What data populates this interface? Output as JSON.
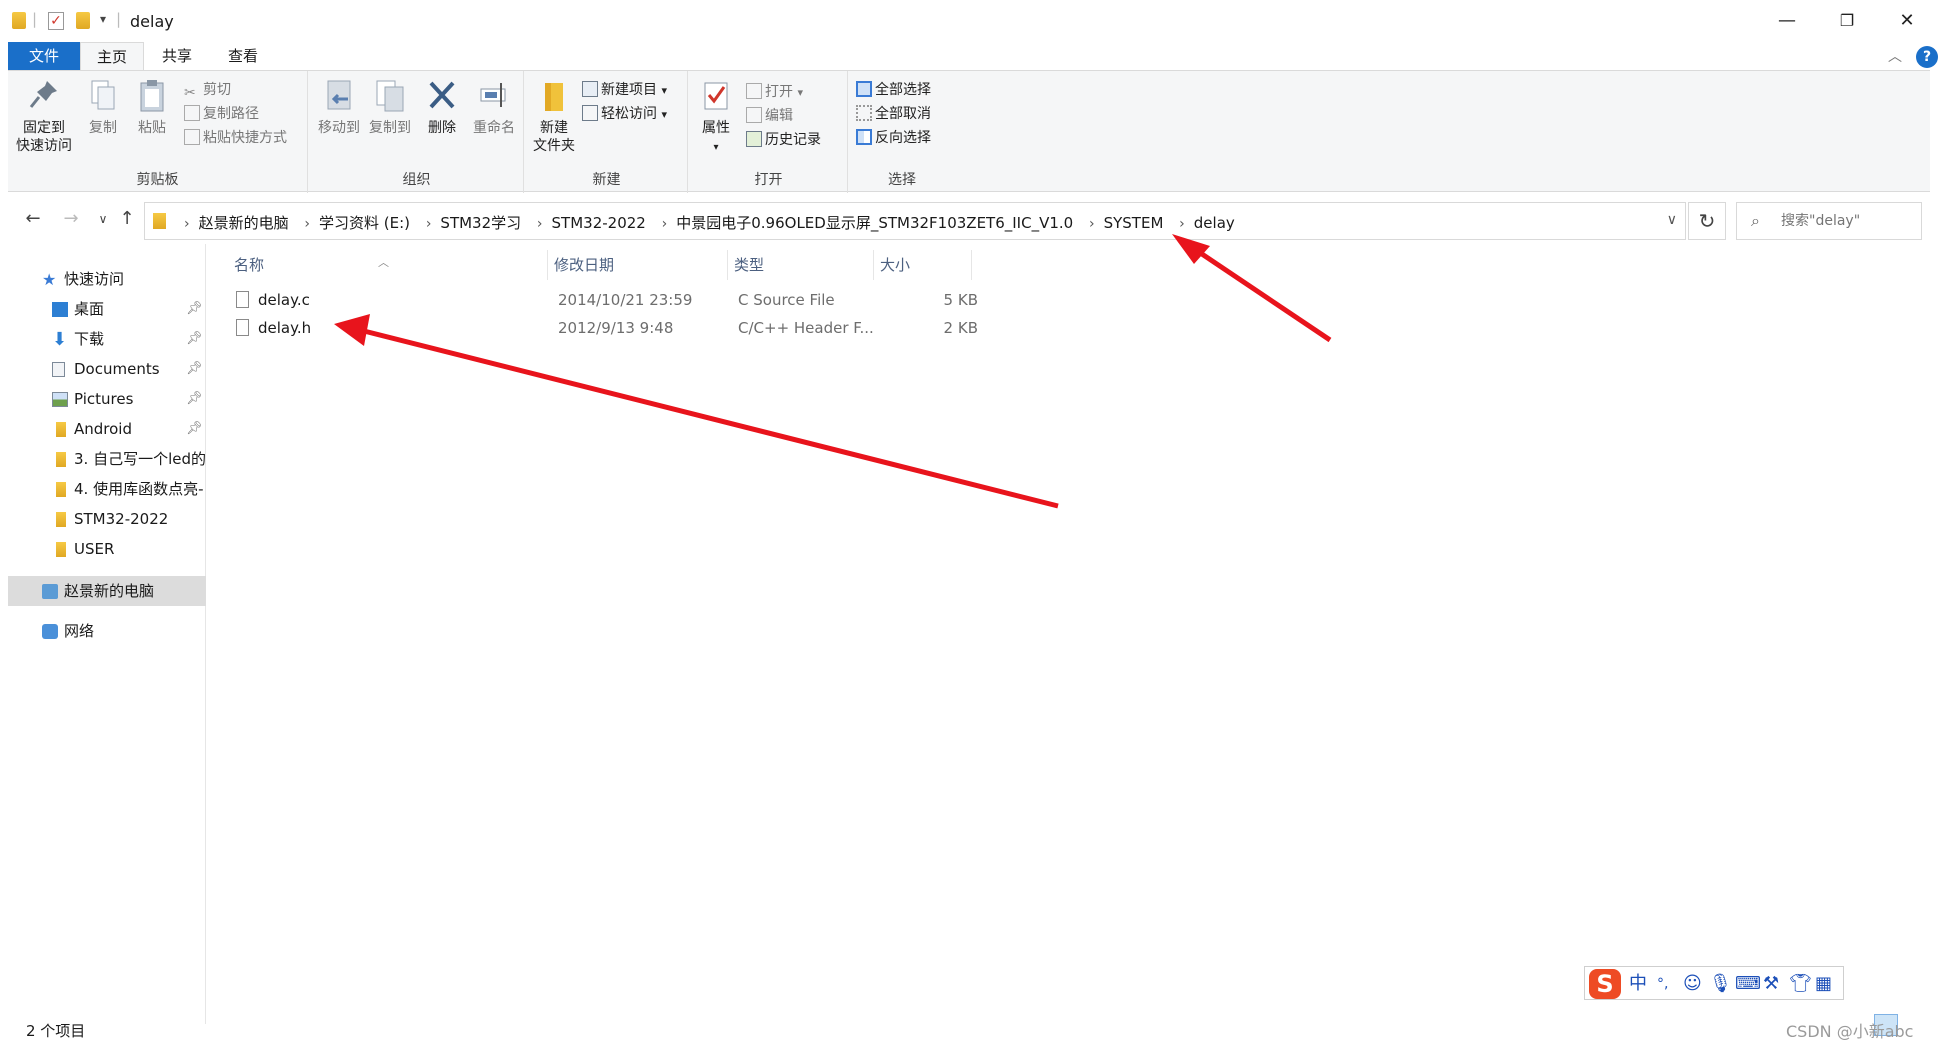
{
  "window": {
    "title": "delay",
    "controls": {
      "minimize": "—",
      "maximize": "❐",
      "close": "✕"
    }
  },
  "ribbon_tabs": [
    "文件",
    "主页",
    "共享",
    "查看"
  ],
  "ribbon": {
    "clipboard": {
      "label": "剪贴板",
      "pin_line1": "固定到",
      "pin_line2": "快速访问",
      "copy": "复制",
      "paste": "粘贴",
      "cut": "剪切",
      "copy_path": "复制路径",
      "paste_shortcut": "粘贴快捷方式"
    },
    "organize": {
      "label": "组织",
      "move_to": "移动到",
      "copy_to": "复制到",
      "delete": "删除",
      "rename": "重命名"
    },
    "new": {
      "label": "新建",
      "new_folder_line1": "新建",
      "new_folder_line2": "文件夹",
      "new_item": "新建项目",
      "easy_access": "轻松访问"
    },
    "open": {
      "label": "打开",
      "properties": "属性",
      "open": "打开",
      "edit": "编辑",
      "history": "历史记录"
    },
    "select": {
      "label": "选择",
      "select_all": "全部选择",
      "select_none": "全部取消",
      "invert": "反向选择"
    }
  },
  "address": {
    "crumbs": [
      "赵景新的电脑",
      "学习资料 (E:)",
      "STM32学习",
      "STM32-2022",
      "中景园电子0.96OLED显示屏_STM32F103ZET6_IIC_V1.0",
      "SYSTEM",
      "delay"
    ]
  },
  "search": {
    "placeholder": "搜索\"delay\""
  },
  "sidebar": {
    "quick_access": "快速访问",
    "items": [
      {
        "label": "桌面",
        "pinned": true
      },
      {
        "label": "下载",
        "pinned": true
      },
      {
        "label": "Documents",
        "pinned": true
      },
      {
        "label": "Pictures",
        "pinned": true
      },
      {
        "label": "Android",
        "pinned": true
      },
      {
        "label": "3. 自己写一个led的",
        "pinned": false
      },
      {
        "label": "4. 使用库函数点亮-",
        "pinned": false
      },
      {
        "label": "STM32-2022",
        "pinned": false
      },
      {
        "label": "USER",
        "pinned": false
      }
    ],
    "this_pc": "赵景新的电脑",
    "network": "网络"
  },
  "columns": {
    "name": "名称",
    "date": "修改日期",
    "type": "类型",
    "size": "大小"
  },
  "files": [
    {
      "name": "delay.c",
      "date": "2014/10/21 23:59",
      "type": "C Source File",
      "size": "5 KB"
    },
    {
      "name": "delay.h",
      "date": "2012/9/13 9:48",
      "type": "C/C++ Header F...",
      "size": "2 KB"
    }
  ],
  "status": {
    "count": "2 个项目"
  },
  "ime": {
    "logo": "S",
    "mode": "中",
    "punct": "°,"
  },
  "watermark": "CSDN @小新abc",
  "colors": {
    "accent": "#1a6fc9",
    "arrow": "#e8141c",
    "ime": "#ee4b24"
  }
}
